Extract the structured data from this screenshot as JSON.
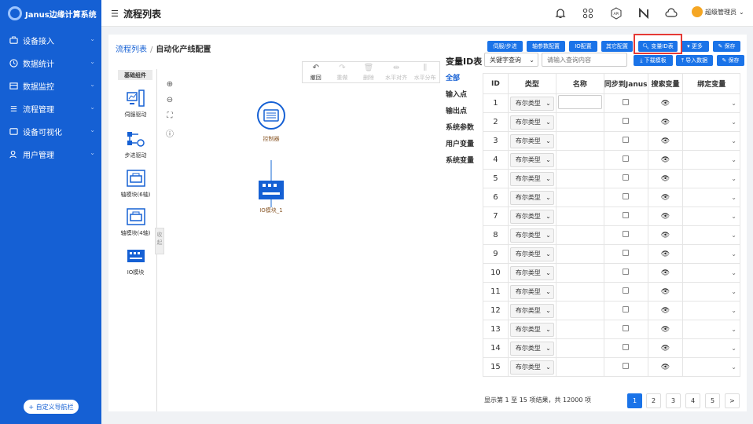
{
  "app": {
    "title": "Janus边缘计算系统"
  },
  "sidebar": {
    "items": [
      {
        "label": "设备接入",
        "icon": "device-icon"
      },
      {
        "label": "数据统计",
        "icon": "clock-icon"
      },
      {
        "label": "数据监控",
        "icon": "monitor-icon"
      },
      {
        "label": "流程管理",
        "icon": "flow-icon"
      },
      {
        "label": "设备可视化",
        "icon": "visual-icon"
      },
      {
        "label": "用户管理",
        "icon": "user-icon"
      }
    ],
    "custom_nav": "+ 自定义导航栏"
  },
  "topbar": {
    "title": "流程列表",
    "user": "超级管理员"
  },
  "breadcrumb": {
    "parent": "流程列表",
    "separator": "/",
    "current": "自动化产线配置"
  },
  "toolbar": {
    "items": [
      {
        "label": "撤回",
        "glyph": "↶",
        "enabled": true
      },
      {
        "label": "重做",
        "glyph": "↷",
        "enabled": false
      },
      {
        "label": "删除",
        "glyph": "🗑",
        "enabled": false
      },
      {
        "label": "水平对齐",
        "glyph": "⇹",
        "enabled": false
      },
      {
        "label": "水平分布",
        "glyph": "⫼",
        "enabled": false
      }
    ]
  },
  "palette": {
    "header": "基础组件",
    "items": [
      "伺服驱动",
      "步进驱动",
      "轴模块(6轴)",
      "轴模块(4轴)",
      "IO模块"
    ]
  },
  "canvas": {
    "collapse": "收起",
    "nodes": {
      "controller": "控制器",
      "io": "IO模块_1"
    }
  },
  "config_buttons": {
    "servo": "伺服/步进",
    "axis": "轴参数配置",
    "io": "IO配置",
    "other": "其它配置",
    "var_table": "变量ID表",
    "more": "更多",
    "save": "保存"
  },
  "variables": {
    "title": "变量ID表",
    "categories": [
      "全部",
      "输入点",
      "输出点",
      "系统参数",
      "用户变量",
      "系统变量"
    ]
  },
  "search": {
    "mode": "关键字查询",
    "placeholder": "请输入查询内容",
    "download": "下载模板",
    "import": "导入数据",
    "save": "保存"
  },
  "table": {
    "headers": [
      "ID",
      "类型",
      "名称",
      "同步到Janus",
      "搜索变量",
      "绑定变量"
    ],
    "type_value": "布尔类型",
    "rows": [
      "1",
      "2",
      "3",
      "4",
      "5",
      "6",
      "7",
      "8",
      "9",
      "10",
      "11",
      "12",
      "13",
      "14",
      "15"
    ]
  },
  "pagination": {
    "summary": "显示第 1 至 15 项结果，共 12000 项",
    "pages": [
      "1",
      "2",
      "3",
      "4",
      "5"
    ],
    "next": ">"
  }
}
